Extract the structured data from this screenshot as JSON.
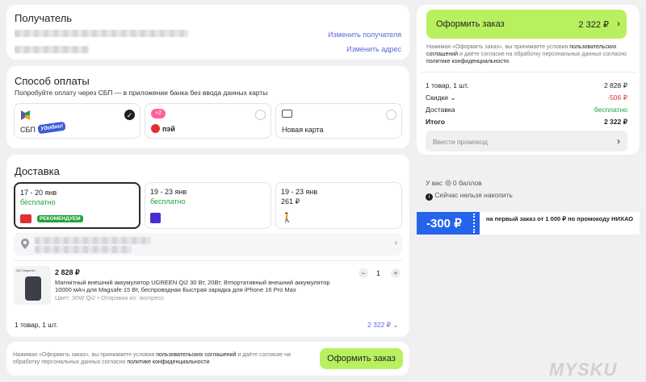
{
  "recipient": {
    "title": "Получатель",
    "change_recipient": "Изменить получателя",
    "change_address": "Изменить адрес"
  },
  "payment": {
    "title": "Способ оплаты",
    "subtitle": "Попробуйте оплату через СБП — в приложении банка без ввода данных карты",
    "options": [
      {
        "label": "СБП",
        "badge": "Удобно!",
        "selected": true
      },
      {
        "label": "пэй",
        "badge": "",
        "selected": false
      },
      {
        "label": "Новая карта",
        "badge": "",
        "selected": false
      }
    ]
  },
  "delivery": {
    "title": "Доставка",
    "options": [
      {
        "dates": "17 - 20 янв",
        "price": "бесплатно",
        "badge": "РЕКОМЕНДУЕМ",
        "selected": true
      },
      {
        "dates": "19 - 23 янв",
        "price": "бесплатно",
        "badge": "",
        "selected": false
      },
      {
        "dates": "19 - 23 янв",
        "price": "261 ₽",
        "badge": "",
        "selected": false
      }
    ]
  },
  "product": {
    "price": "2 828 ₽",
    "name": "Магнитный внешний аккумулятор UGREEN Qi2 30 Вт, 20Вт, Втпортативный внешний аккумулятор 10000 мАч для Magsafe 15 Вт, беспроводная Быстрая зарядка для iPhone 16 Pro Max",
    "meta": "Цвет: 30W Qi2 • Отправка из: экспресс",
    "qty": "1",
    "thumb_text": "Qi2 Magnetic"
  },
  "items_summary": {
    "label": "1 товар, 1 шт.",
    "total": "2 322 ₽"
  },
  "footer": {
    "terms_pre": "Нажимая «Оформить заказ», вы принимаете условия ",
    "terms_link1": "пользовательских соглашений",
    "terms_mid": " и даёте согласие на обработку персональных данных согласно ",
    "terms_link2": "политике конфиденциальности",
    "button": "Оформить заказ"
  },
  "sidebar": {
    "checkout_label": "Оформить заказ",
    "checkout_total": "2 322 ₽",
    "terms_pre": "Нажимая «Оформить заказ», вы принимаете условия ",
    "terms_link1": "пользовательских соглашений",
    "terms_mid": " и даёте согласие на обработку персональных данных согласно ",
    "terms_link2": "политике конфиденциальности",
    "rows": [
      {
        "label": "1 товар, 1 шт.",
        "value": "2 828 ₽"
      },
      {
        "label": "Скидки",
        "value": "-506 ₽"
      },
      {
        "label": "Доставка",
        "value": "бесплатно"
      },
      {
        "label": "Итого",
        "value": "2 322 ₽"
      }
    ],
    "promo_placeholder": "Ввести промокод",
    "points": "У вас",
    "points_value": "0 баллов",
    "points_note": "Сейчас нельзя накопить",
    "coupon_amount": "-300 ₽",
    "coupon_text": "на первый заказ от 1 000 ₽ по промокоду НИХАО"
  },
  "watermark": "MYSKU",
  "colors": {
    "accent_green": "#b8f05f",
    "discount_red": "#e0352b",
    "link_blue": "#5a67d8",
    "coupon_blue": "#2563eb"
  }
}
